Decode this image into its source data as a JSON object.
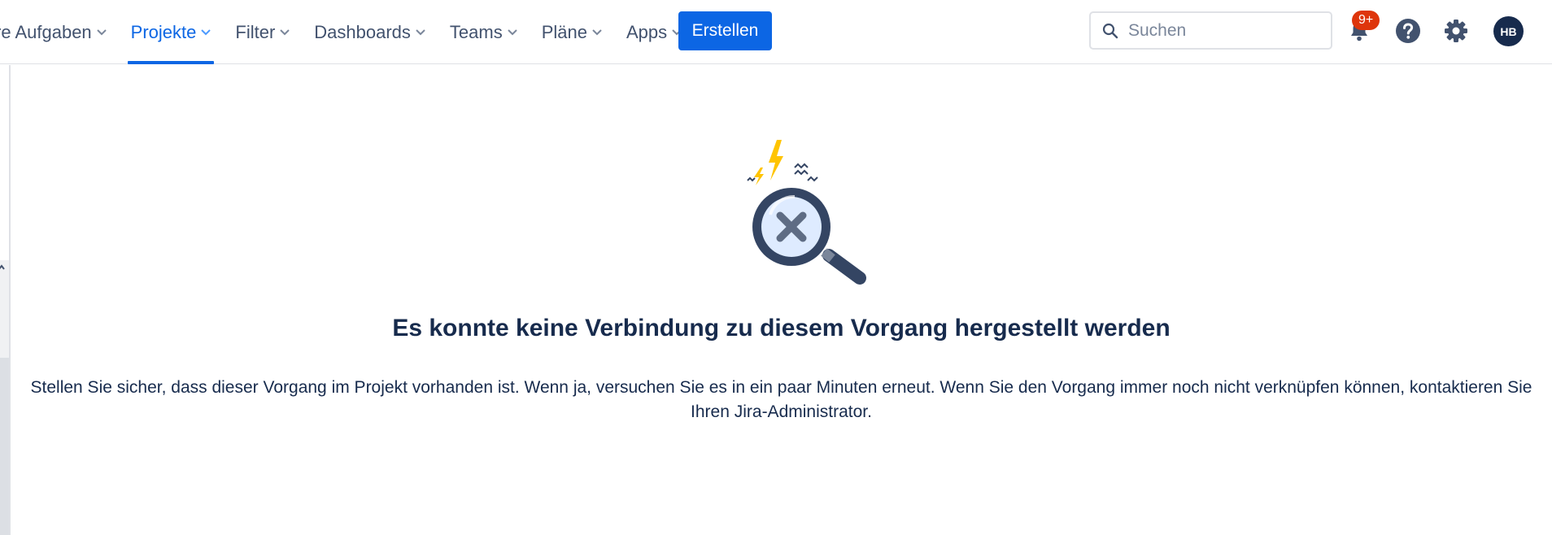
{
  "nav": {
    "items": [
      {
        "label": "re Aufgaben",
        "active": false
      },
      {
        "label": "Projekte",
        "active": true
      },
      {
        "label": "Filter",
        "active": false
      },
      {
        "label": "Dashboards",
        "active": false
      },
      {
        "label": "Teams",
        "active": false
      },
      {
        "label": "Pläne",
        "active": false
      },
      {
        "label": "Apps",
        "active": false
      }
    ],
    "create_label": "Erstellen"
  },
  "search": {
    "placeholder": "Suchen",
    "value": ""
  },
  "notifications": {
    "badge": "9+",
    "icon": "notification-bell-icon"
  },
  "help": {
    "icon": "help-icon"
  },
  "settings": {
    "icon": "gear-icon"
  },
  "avatar": {
    "initials": "HB"
  },
  "error": {
    "title": "Es konnte keine Verbindung zu diesem Vorgang hergestellt werden",
    "message": "Stellen Sie sicher, dass dieser Vorgang im Projekt vorhanden ist. Wenn ja, versuchen Sie es in ein paar Minuten erneut. Wenn Sie den Vorgang immer noch nicht verknüpfen können, kontaktieren Sie Ihren Jira-Administrator."
  },
  "colors": {
    "accent": "#0c66e4",
    "text": "#172b4d",
    "nav_text": "#42526e",
    "badge": "#de350b",
    "lightning": "#ffc400"
  }
}
